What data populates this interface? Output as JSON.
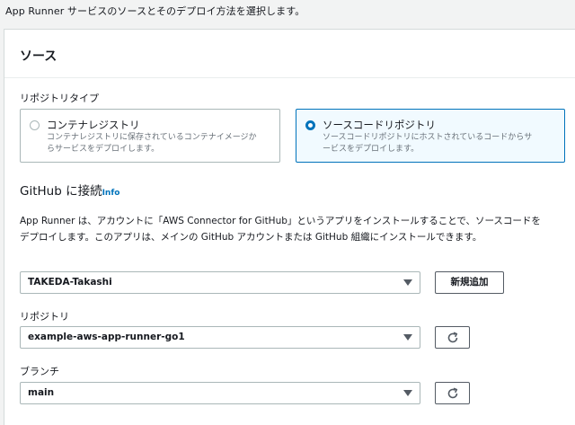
{
  "intro_text": "App Runner サービスのソースとそのデプロイ方法を選択します。",
  "panel": {
    "title": "ソース",
    "repo_type_label": "リポジトリタイプ",
    "repo_type_options": [
      {
        "title": "コンテナレジストリ",
        "description_line1": "コンテナレジストリに保存されているコンテナイメージか",
        "description_line2": "らサービスをデプロイします。",
        "selected": false
      },
      {
        "title": "ソースコードリポジトリ",
        "description_line1": "ソースコードリポジトリにホストされているコードからサ",
        "description_line2": "ービスをデプロイします。",
        "selected": true
      }
    ],
    "github_heading": "GitHub に接続",
    "info_link": "Info",
    "description_line1": "App Runner は、アカウントに「AWS Connector for GitHub」というアプリをインストールすることで、ソースコードを",
    "description_line2": "デプロイします。このアプリは、メインの GitHub アカウントまたは GitHub 組織にインストールできます。",
    "connection_value": "TAKEDA-Takashi",
    "add_new_label": "新規追加",
    "repository_label": "リポジトリ",
    "repository_value": "example-aws-app-runner-go1",
    "branch_label": "ブランチ",
    "branch_value": "main"
  },
  "icons": {
    "caret": "caret-down-icon",
    "refresh": "refresh-icon"
  },
  "colors": {
    "accent": "#0073bb",
    "background": "#f2f3f3",
    "selected_tile_bg": "#f1faff"
  }
}
